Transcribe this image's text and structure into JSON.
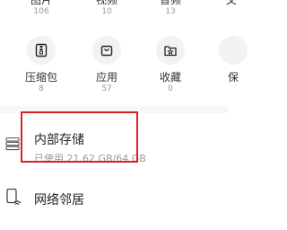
{
  "top_categories": [
    {
      "label": "图片",
      "count": "106"
    },
    {
      "label": "视频",
      "count": "10"
    },
    {
      "label": "音频",
      "count": "13"
    },
    {
      "label": "文",
      "count": ""
    }
  ],
  "grid_categories": [
    {
      "label": "压缩包",
      "count": "8",
      "icon": "archive-icon"
    },
    {
      "label": "应用",
      "count": "57",
      "icon": "app-bag-icon"
    },
    {
      "label": "收藏",
      "count": "0",
      "icon": "favorites-star-icon"
    },
    {
      "label": "保",
      "count": "",
      "icon": "safe-icon"
    }
  ],
  "storage": {
    "title": "内部存储",
    "usage": "已使用 21.62 GB/64 GB",
    "icon": "internal-storage-icon"
  },
  "network": {
    "label": "网络邻居",
    "icon": "network-neighborhood-icon"
  },
  "colors": {
    "highlight": "#e02020",
    "icon_bg": "#f2f2f2",
    "muted_text": "#999999"
  }
}
